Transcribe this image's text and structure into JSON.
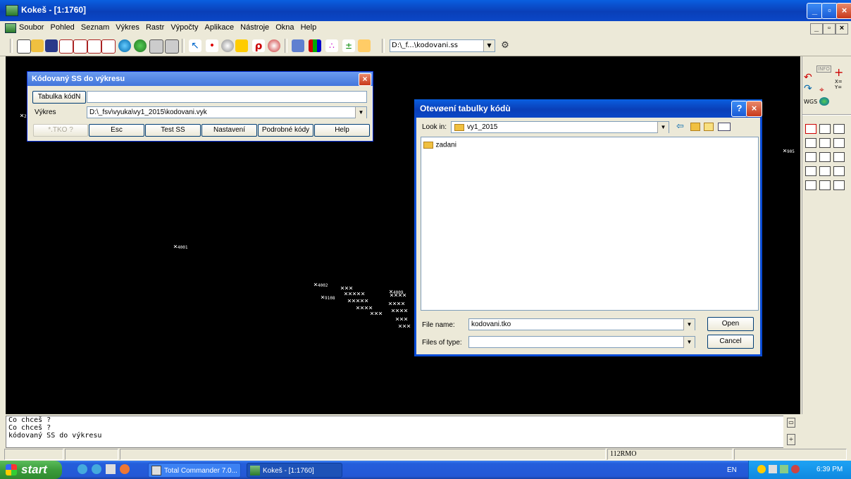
{
  "window": {
    "title": "Kokeš - [1:1760]"
  },
  "menu": {
    "items": [
      "Soubor",
      "Pohled",
      "Seznam",
      "Výkres",
      "Rastr",
      "Výpočty",
      "Aplikace",
      "Nástroje",
      "Okna",
      "Help"
    ]
  },
  "toolbar": {
    "layer_combo": "D:\\_f...\\kodovani.ss"
  },
  "canvas": {
    "points": [
      "4001",
      "4002",
      "9108",
      "4009",
      "905"
    ]
  },
  "dialog_kodovany": {
    "title": "Kódovaný SS do výkresu",
    "tabulka_button": "Tabulka kódN",
    "tabulka_value": "",
    "vykres_label": "Výkres",
    "vykres_value": "D:\\_fsv\\vyuka\\vy1_2015\\kodovani.vyk",
    "buttons": [
      "*.TKO ?",
      "Esc",
      "Test SS",
      "Nastavení",
      "Podrobné kódy",
      "Help"
    ]
  },
  "dialog_open": {
    "title": "Otevøení tabulky kódù",
    "look_in_label": "Look in:",
    "look_in_value": "vy1_2015",
    "files": [
      "zadani"
    ],
    "filename_label": "File name:",
    "filename_value": "kodovani.tko",
    "filetype_label": "Files of type:",
    "filetype_value": "",
    "open_button": "Open",
    "cancel_button": "Cancel"
  },
  "palette": {
    "info_label": "INFO",
    "xy_label": "X=\nY=",
    "wgs_label": "WGS"
  },
  "command": {
    "lines": [
      "Co chceš ?",
      "Co chceš ?",
      "kódovaný SS do výkresu"
    ]
  },
  "status": {
    "code": "112RMO"
  },
  "taskbar": {
    "start": "start",
    "tasks": [
      "Total Commander 7.0...",
      "Kokeš - [1:1760]"
    ],
    "lang": "EN",
    "clock": "6:39 PM"
  }
}
